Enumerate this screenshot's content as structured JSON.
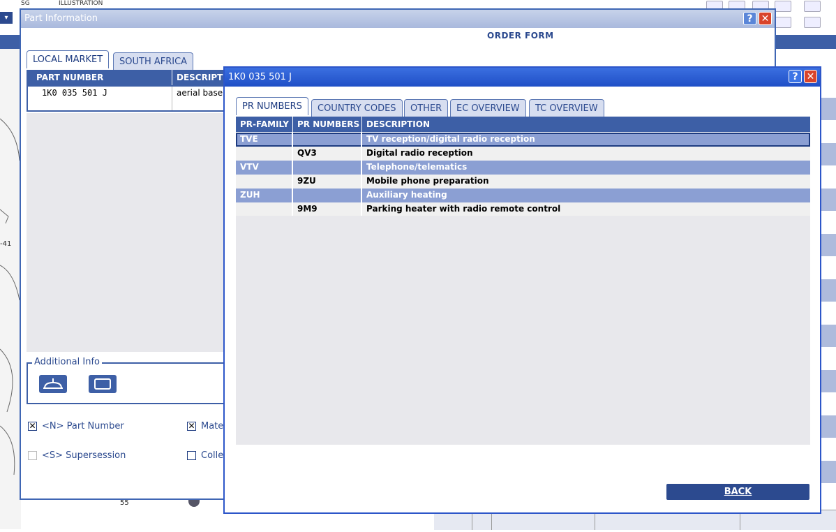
{
  "top_bar": {
    "label_sg": "SG",
    "label_illustration": "ILLUSTRATION",
    "dropdown_glyph": "▾"
  },
  "background": {
    "drawing_callout_41": "-41",
    "drawing_callout_55": "55"
  },
  "part_dialog": {
    "title": "Part Information",
    "help_glyph": "?",
    "close_glyph": "✕",
    "order_form": "ORDER FORM",
    "tabs": [
      {
        "label": "LOCAL MARKET",
        "active": true
      },
      {
        "label": "SOUTH AFRICA",
        "active": false
      }
    ],
    "table": {
      "headers": [
        "PART NUMBER",
        "DESCRIPTI"
      ],
      "rows": [
        {
          "part_number": "1K0 035 501 J",
          "description": "aerial base"
        }
      ]
    },
    "additional_info": {
      "legend": "Additional Info"
    },
    "checkboxes": [
      {
        "label": "<N> Part Number",
        "checked": true,
        "enabled": true
      },
      {
        "label": "Mater",
        "checked": true,
        "enabled": true
      },
      {
        "label": "<S> Supersession",
        "checked": false,
        "enabled": false
      },
      {
        "label": "Colle",
        "checked": false,
        "enabled": true
      }
    ]
  },
  "pr_dialog": {
    "title": "1K0 035 501 J",
    "help_glyph": "?",
    "close_glyph": "✕",
    "tabs": [
      {
        "label": "PR NUMBERS",
        "active": true
      },
      {
        "label": "COUNTRY CODES",
        "active": false
      },
      {
        "label": "OTHER",
        "active": false
      },
      {
        "label": "EC OVERVIEW",
        "active": false
      },
      {
        "label": "TC OVERVIEW",
        "active": false
      }
    ],
    "table": {
      "headers": [
        "PR-FAMILY",
        "PR NUMBERS",
        "DESCRIPTION"
      ],
      "rows": [
        {
          "type": "family",
          "family": "TVE",
          "pr": "",
          "description": "TV reception/digital radio reception",
          "selected": true
        },
        {
          "type": "item",
          "family": "",
          "pr": "QV3",
          "description": "Digital radio reception"
        },
        {
          "type": "family",
          "family": "VTV",
          "pr": "",
          "description": "Telephone/telematics"
        },
        {
          "type": "item",
          "family": "",
          "pr": "9ZU",
          "description": "Mobile phone preparation"
        },
        {
          "type": "family",
          "family": "ZUH",
          "pr": "",
          "description": "Auxiliary heating"
        },
        {
          "type": "item",
          "family": "",
          "pr": "9M9",
          "description": "Parking heater with radio remote control"
        }
      ]
    },
    "back_button": "BACK"
  },
  "colors": {
    "primary_blue": "#3d5fa6",
    "title_blue": "#1f4fc7",
    "family_row": "#8b9fd3",
    "close_red": "#d9442a"
  }
}
